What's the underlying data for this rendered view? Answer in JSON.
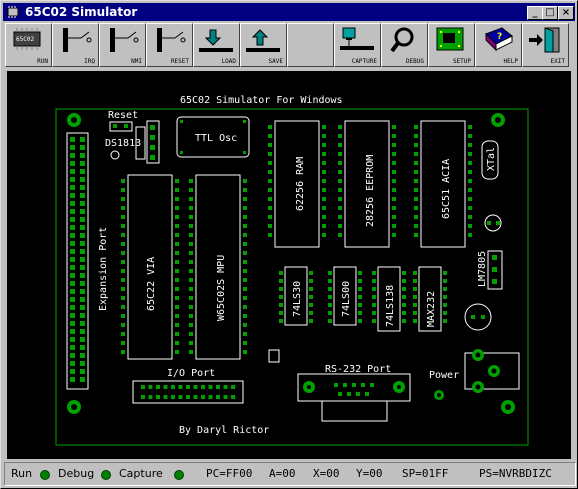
{
  "window": {
    "title": "65C02 Simulator",
    "controls": [
      "_",
      "□",
      "×"
    ]
  },
  "toolbar": [
    {
      "label": "RUN",
      "icon": "chip-icon"
    },
    {
      "label": "IRQ",
      "icon": "irq-switch-icon"
    },
    {
      "label": "NMI",
      "icon": "nmi-switch-icon"
    },
    {
      "label": "RESET",
      "icon": "reset-switch-icon"
    },
    {
      "label": "LOAD",
      "icon": "load-arrow-icon"
    },
    {
      "label": "SAVE",
      "icon": "save-arrow-icon"
    },
    {
      "label": "CAPTURE",
      "icon": "capture-monitor-icon"
    },
    {
      "label": "DEBUG",
      "icon": "magnifier-icon"
    },
    {
      "label": "SETUP",
      "icon": "circuit-board-icon"
    },
    {
      "label": "HELP",
      "icon": "help-book-icon"
    },
    {
      "label": "EXIT",
      "icon": "exit-door-icon"
    }
  ],
  "board": {
    "title": "65C02 Simulator For Windows",
    "author": "By Daryl Rictor",
    "labels": {
      "reset": "Reset",
      "ds1813": "DS1813",
      "ttl_osc": "TTL Osc",
      "ram": "62256 RAM",
      "eeprom": "28256 EEPROM",
      "acia": "65C51 ACIA",
      "xtal": "XTal",
      "expansion": "Expansion Port",
      "via": "65C22 VIA",
      "mpu": "W65C02S MPU",
      "ls30": "74LS30",
      "ls00": "74LS00",
      "ls138": "74LS138",
      "max232": "MAX232",
      "lm7805": "LM7805",
      "io_port": "I/O Port",
      "rs232": "RS-232 Port",
      "power": "Power"
    }
  },
  "status": {
    "run": "Run",
    "debug": "Debug",
    "capture": "Capture",
    "pc": "PC=FF00",
    "a": "A=00",
    "x": "X=00",
    "y": "Y=00",
    "sp": "SP=01FF",
    "ps": "PS=NVRBDIZC"
  },
  "colors": {
    "titlebar": "#000080",
    "board": "#000000",
    "silkscreen": "#ffffff",
    "pads": "#00a000",
    "led": "#008000"
  }
}
